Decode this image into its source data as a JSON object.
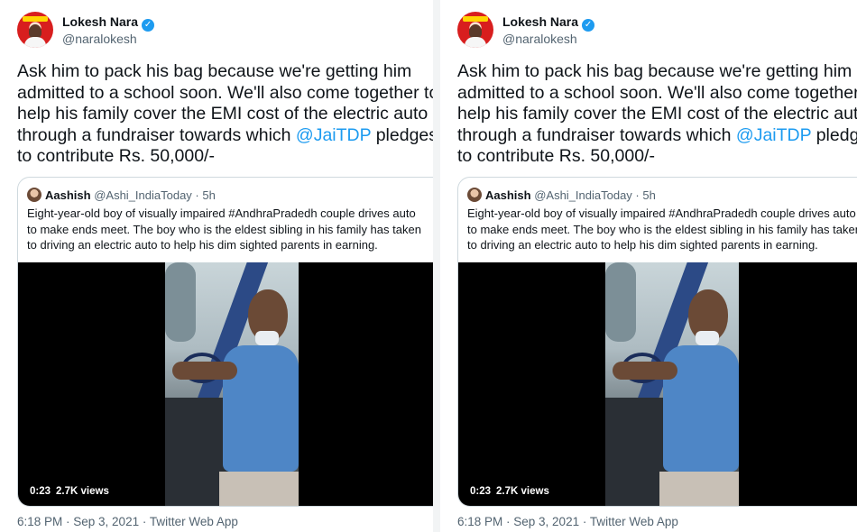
{
  "author": {
    "name": "Lokesh Nara",
    "handle": "@naralokesh",
    "verified_glyph": "✓"
  },
  "tweet": {
    "lines": [
      "Ask him to pack his bag because we're getting him",
      "admitted to a school soon. We'll also come together to",
      "help his family cover the EMI cost of the electric auto",
      "through a fundraiser towards which "
    ],
    "mention": "@JaiTDP",
    "line4_tail": " pledges",
    "line5": "to contribute Rs. 50,000/-"
  },
  "quoted": {
    "name": "Aashish",
    "handle": "@Ashi_IndiaToday",
    "separator": " · ",
    "time": "5h",
    "lines": [
      "Eight-year-old boy of visually impaired #AndhraPradedh couple drives auto",
      "to make ends meet. The boy who is the eldest sibling in his family has taken",
      "to driving an electric auto to help his dim sighted parents in earning."
    ],
    "video": {
      "duration": "0:23",
      "views": "2.7K views"
    }
  },
  "meta": {
    "text": "6:18 PM · Sep 3, 2021 · Twitter Web App"
  },
  "colors": {
    "link": "#1d9bf0",
    "secondary_text": "#536471",
    "border": "#cfd9de"
  },
  "icons": {
    "verified": "verified-badge-icon"
  }
}
